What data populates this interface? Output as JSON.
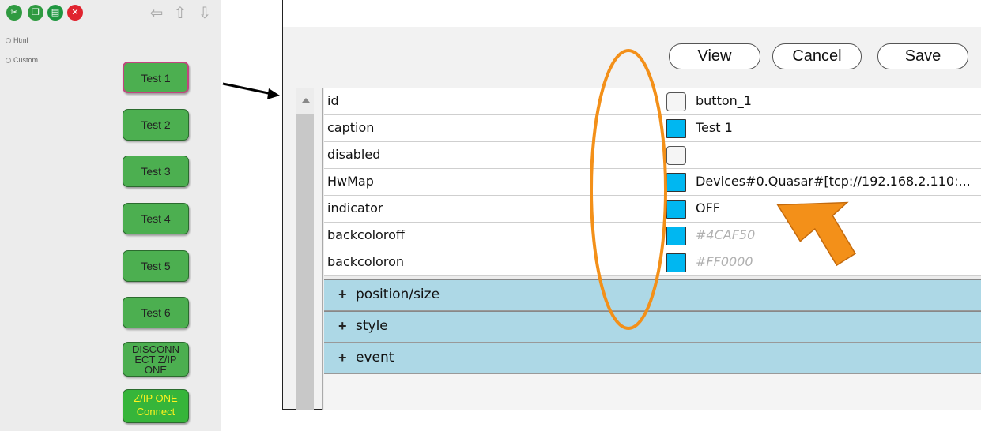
{
  "left_panel": {
    "toolbar": {
      "icons": [
        "scissors-icon",
        "copy-icon",
        "paste-icon",
        "delete-icon"
      ],
      "nav_icons": [
        "arrow-left-icon",
        "arrow-up-icon",
        "arrow-down-icon"
      ]
    },
    "tree": [
      {
        "label": "Html"
      },
      {
        "label": "Custom"
      }
    ],
    "buttons": [
      {
        "label": "Test 1"
      },
      {
        "label": "Test 2"
      },
      {
        "label": "Test 3"
      },
      {
        "label": "Test 4"
      },
      {
        "label": "Test 5"
      },
      {
        "label": "Test 6"
      },
      {
        "label": "DISCONN ECT Z/IP ONE"
      },
      {
        "label": "Z/IP ONE Connect"
      }
    ]
  },
  "actions": {
    "view": "View",
    "cancel": "Cancel",
    "save": "Save"
  },
  "properties": [
    {
      "name": "id",
      "value": "button_1",
      "swatch": "empty"
    },
    {
      "name": "caption",
      "value": "Test 1",
      "swatch": "blue"
    },
    {
      "name": "disabled",
      "value": "",
      "swatch": "empty"
    },
    {
      "name": "HwMap",
      "value": "Devices#0.Quasar#[tcp://192.168.2.110:...",
      "swatch": "blue"
    },
    {
      "name": "indicator",
      "value": "OFF",
      "swatch": "blue"
    },
    {
      "name": "backcoloroff",
      "value": "#4CAF50",
      "swatch": "blue",
      "placeholder": true
    },
    {
      "name": "backcoloron",
      "value": "#FF0000",
      "swatch": "blue",
      "placeholder": true
    }
  ],
  "groups": [
    {
      "label": "position/size"
    },
    {
      "label": "style"
    },
    {
      "label": "event"
    }
  ],
  "colors": {
    "button_green": "#4caf50",
    "swatch_blue": "#00b7f1",
    "group_bg": "#add8e6",
    "annotation_orange": "#f39019"
  }
}
